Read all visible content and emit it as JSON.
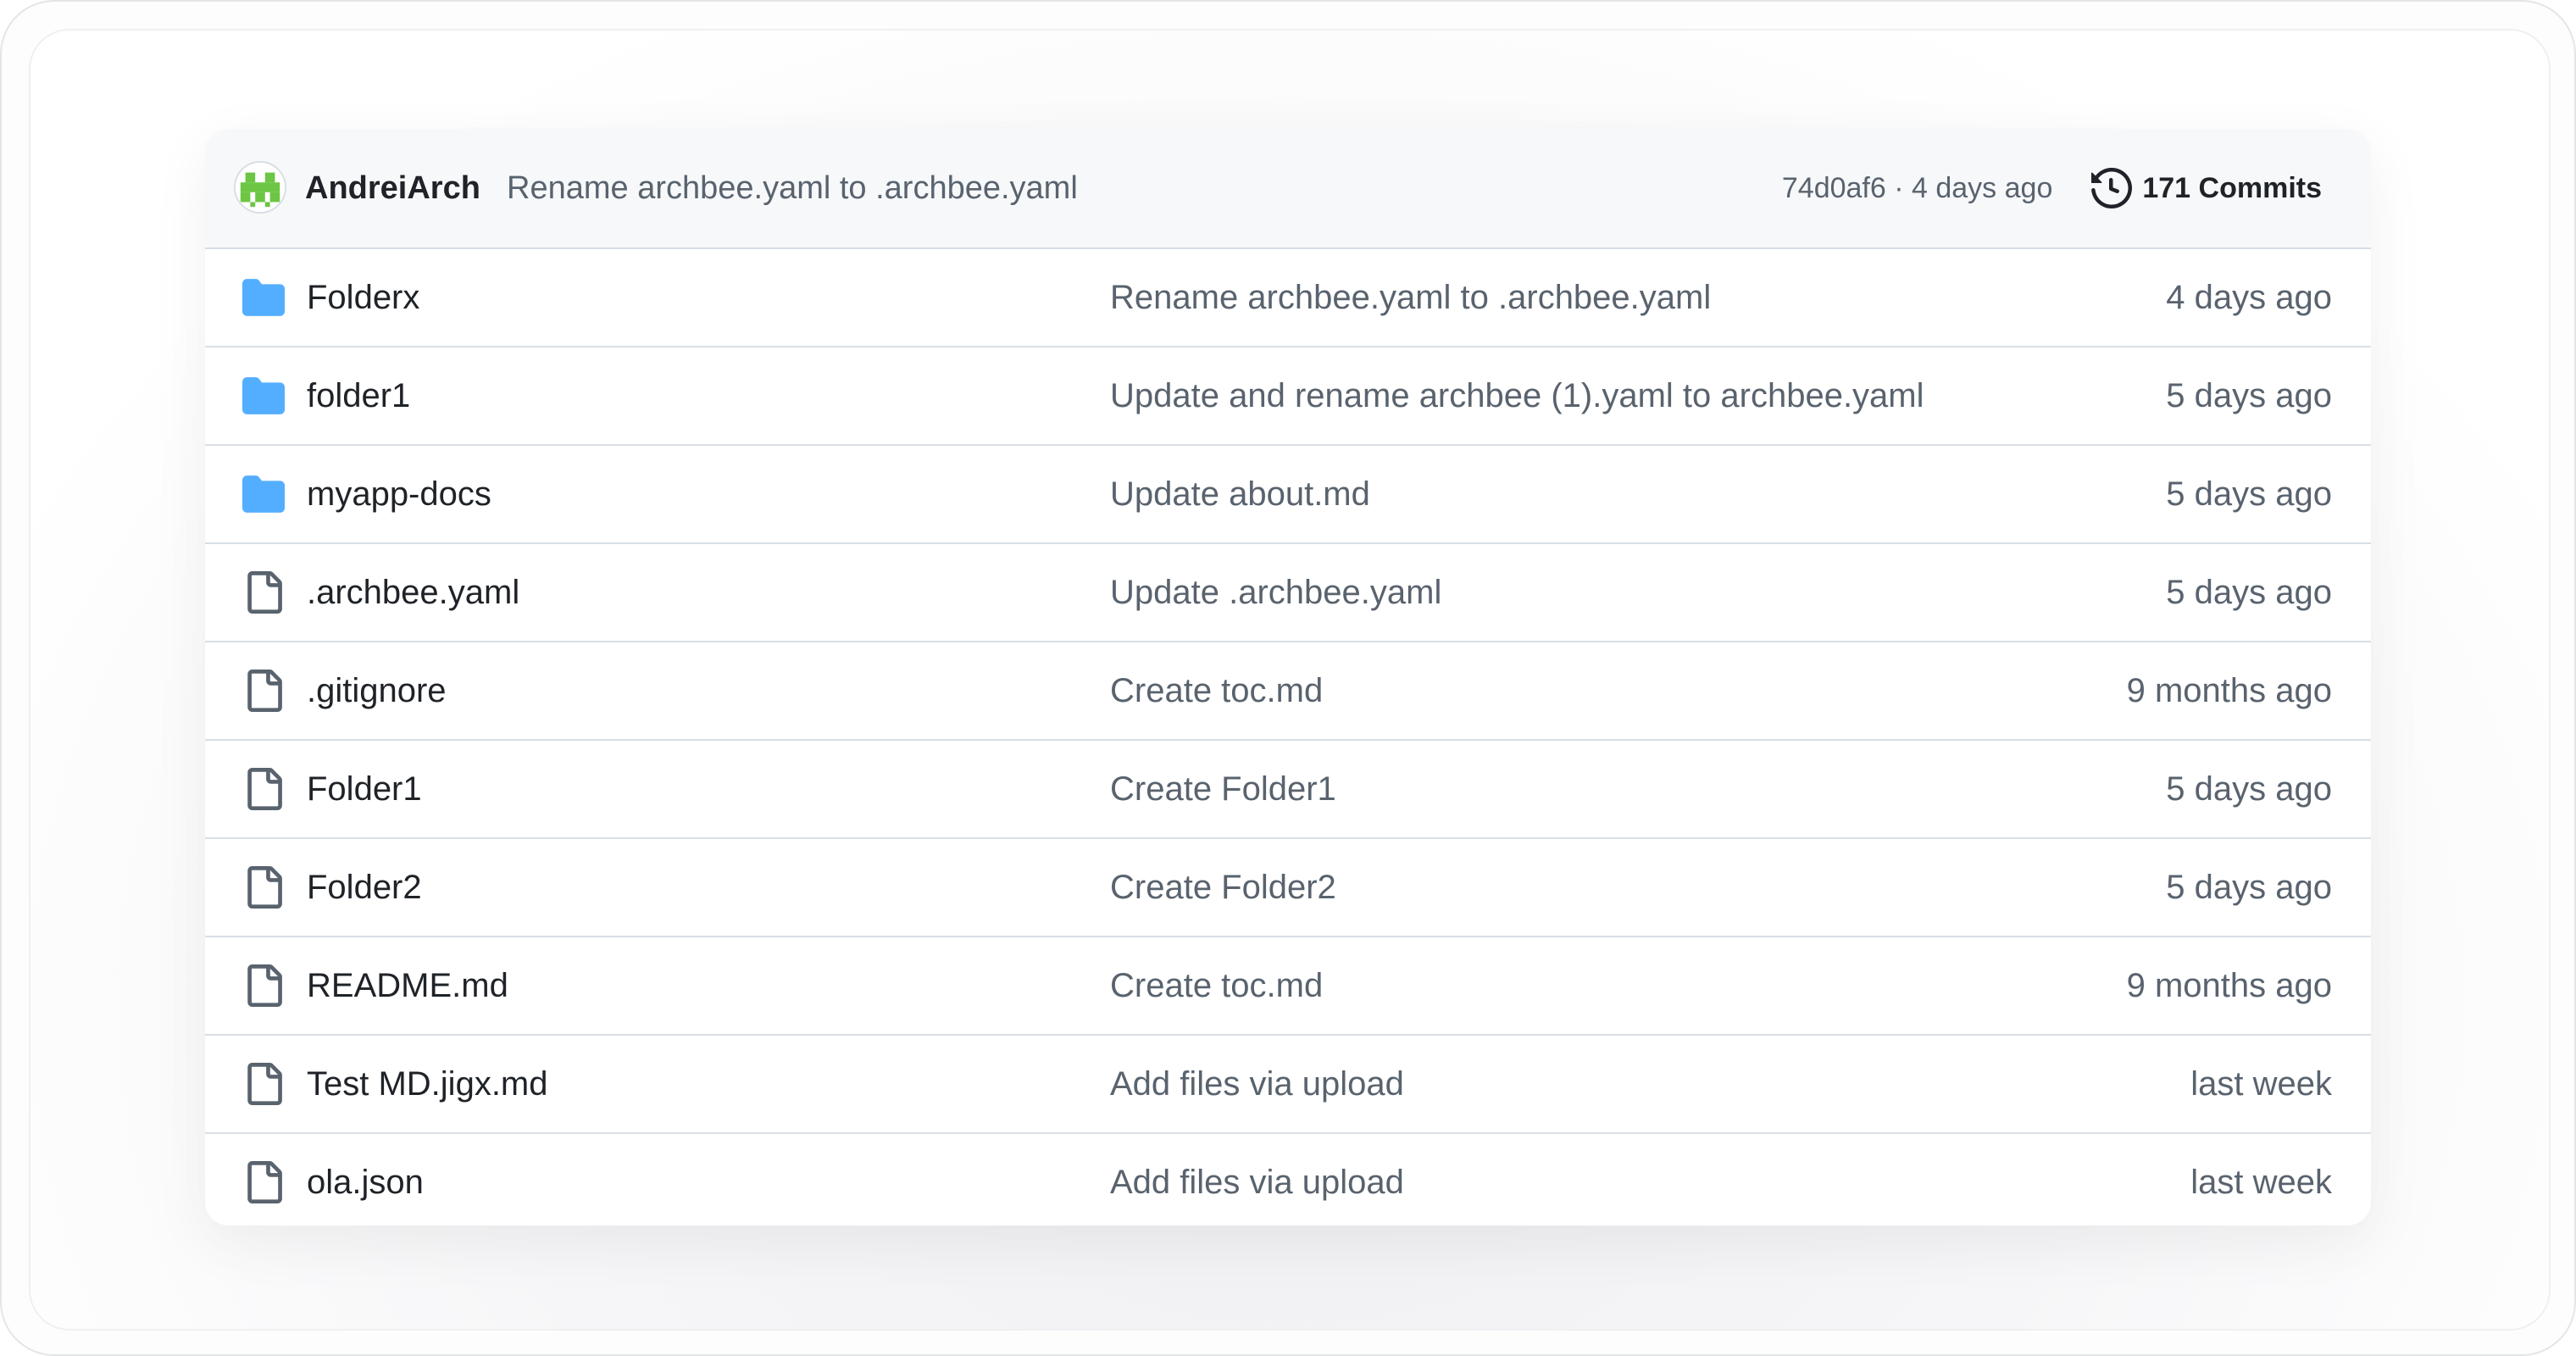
{
  "latest_commit": {
    "author": "AndreiArch",
    "message": "Rename archbee.yaml to .archbee.yaml",
    "sha_and_age": "74d0af6 · 4 days ago",
    "commits_label": "171 Commits"
  },
  "files": [
    {
      "type": "folder",
      "name": "Folderx",
      "commit_message": "Rename archbee.yaml to .archbee.yaml",
      "age": "4 days ago"
    },
    {
      "type": "folder",
      "name": "folder1",
      "commit_message": "Update and rename archbee (1).yaml to archbee.yaml",
      "age": "5 days ago"
    },
    {
      "type": "folder",
      "name": "myapp-docs",
      "commit_message": "Update about.md",
      "age": "5 days ago"
    },
    {
      "type": "file",
      "name": ".archbee.yaml",
      "commit_message": "Update .archbee.yaml",
      "age": "5 days ago"
    },
    {
      "type": "file",
      "name": ".gitignore",
      "commit_message": "Create toc.md",
      "age": "9 months ago"
    },
    {
      "type": "file",
      "name": "Folder1",
      "commit_message": "Create Folder1",
      "age": "5 days ago"
    },
    {
      "type": "file",
      "name": "Folder2",
      "commit_message": "Create Folder2",
      "age": "5 days ago"
    },
    {
      "type": "file",
      "name": "README.md",
      "commit_message": "Create toc.md",
      "age": "9 months ago"
    },
    {
      "type": "file",
      "name": "Test MD.jigx.md",
      "commit_message": "Add files via upload",
      "age": "last week"
    },
    {
      "type": "file",
      "name": "ola.json",
      "commit_message": "Add files via upload",
      "age": "last week"
    }
  ],
  "colors": {
    "folder": "#54aeff",
    "file_icon": "#59636e",
    "avatar": "#6cc644",
    "text_primary": "#1f2328",
    "text_muted": "#59636e",
    "border": "#d8dee4",
    "header_bg": "#f6f8fa"
  },
  "icons": {
    "avatar": "identicon-avatar",
    "history": "history-icon",
    "folder": "folder-icon",
    "file": "file-icon"
  }
}
